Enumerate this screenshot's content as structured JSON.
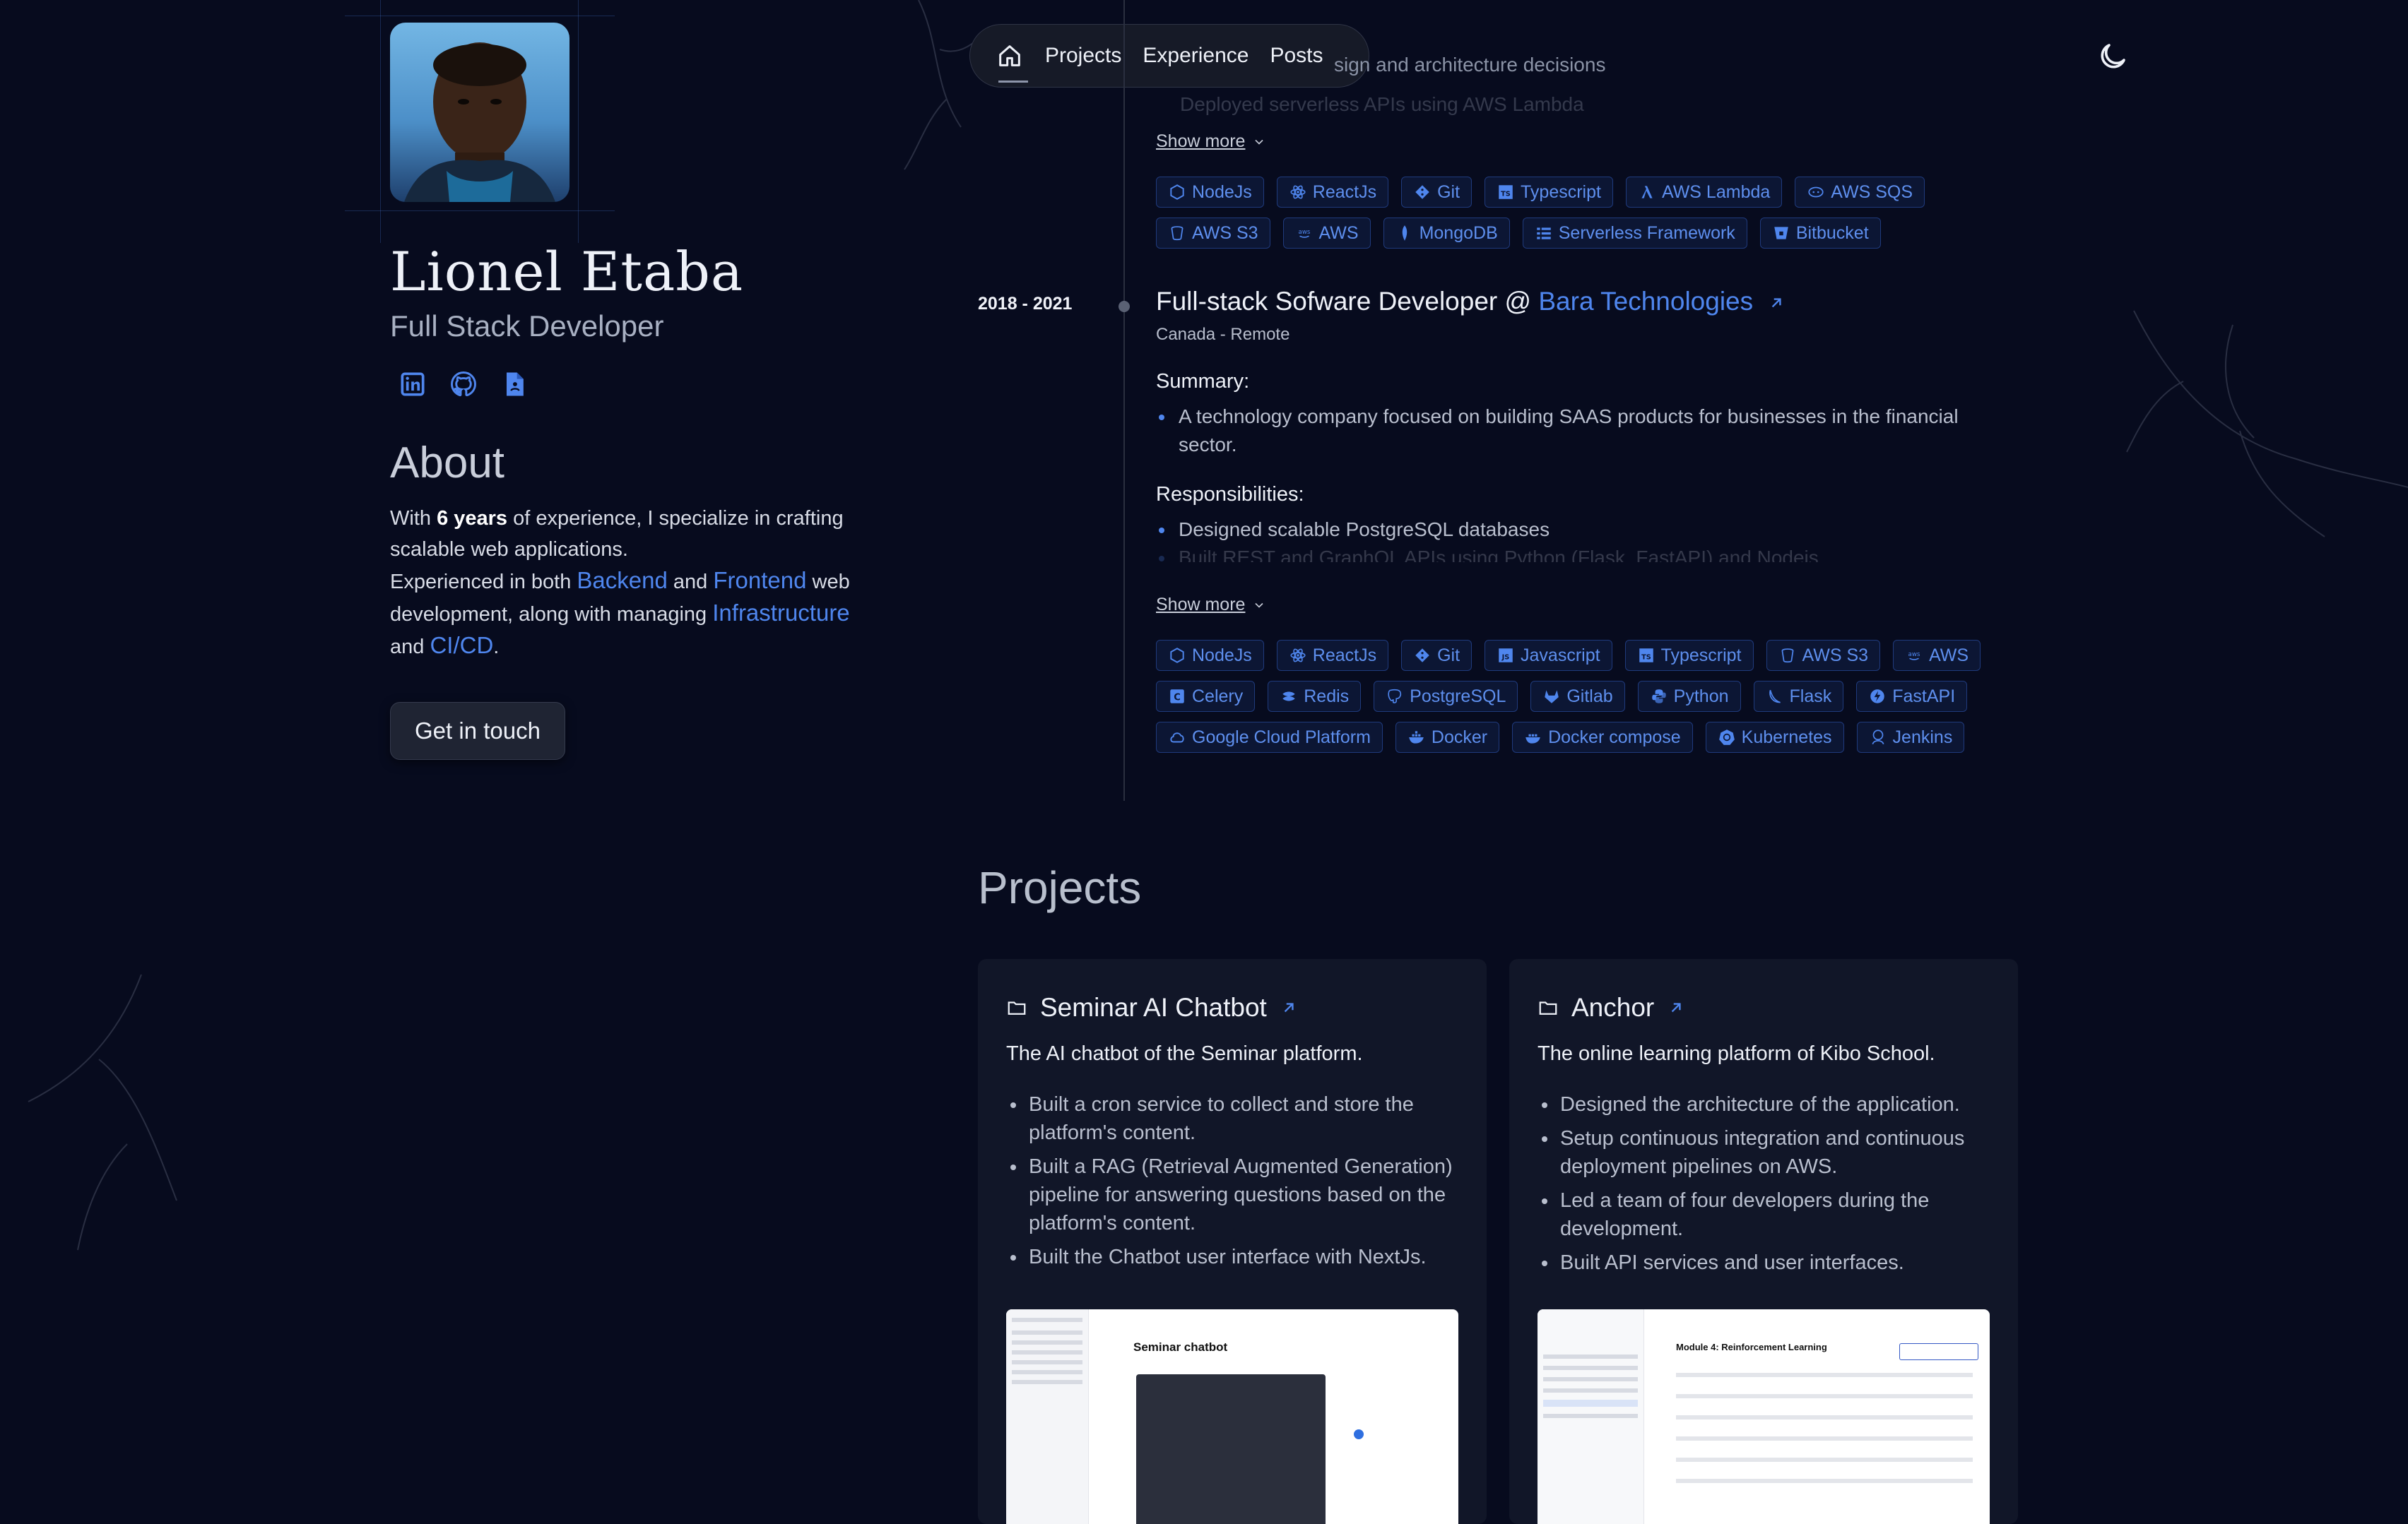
{
  "profile": {
    "name": "Lionel Etaba",
    "role": "Full Stack Developer"
  },
  "about": {
    "heading": "About",
    "p1_pre": "With ",
    "p1_bold": "6 years",
    "p1_post": " of experience, I specialize in crafting scalable web applications.",
    "p2_pre": "Experienced in both ",
    "link_backend": "Backend",
    "and1": " and ",
    "link_frontend": "Frontend",
    "p2_mid": " web development, along with managing ",
    "link_infra": "Infrastructure",
    "and2": " and ",
    "link_cicd": "CI/CD",
    "period": "."
  },
  "cta": "Get in touch",
  "nav": {
    "items": [
      "Projects",
      "Experience",
      "Posts"
    ]
  },
  "previous_job": {
    "line1": "sign and architecture decisions",
    "line2": "Deployed serverless APIs using AWS Lambda",
    "show_more": "Show more",
    "tags": [
      "NodeJs",
      "ReactJs",
      "Git",
      "Typescript",
      "AWS Lambda",
      "AWS SQS",
      "AWS S3",
      "AWS",
      "MongoDB",
      "Serverless Framework",
      "Bitbucket"
    ]
  },
  "job": {
    "dates": "2018 - 2021",
    "title_pre": "Full-stack Sofware Developer @ ",
    "company": "Bara Technologies",
    "location": "Canada - Remote",
    "summary_label": "Summary:",
    "summary": [
      "A technology company focused on building SAAS products for businesses in the financial sector."
    ],
    "responsibilities_label": "Responsibilities:",
    "responsibilities": [
      "Designed scalable PostgreSQL databases",
      "Built REST and GraphQL APIs using Python (Flask, FastAPI) and Nodejs"
    ],
    "show_more": "Show more",
    "tags": [
      "NodeJs",
      "ReactJs",
      "Git",
      "Javascript",
      "Typescript",
      "AWS S3",
      "AWS",
      "Celery",
      "Redis",
      "PostgreSQL",
      "Gitlab",
      "Python",
      "Flask",
      "FastAPI",
      "Google Cloud Platform",
      "Docker",
      "Docker compose",
      "Kubernetes",
      "Jenkins"
    ]
  },
  "projects": {
    "heading": "Projects",
    "cards": [
      {
        "title": "Seminar AI Chatbot",
        "description": "The AI chatbot of the Seminar platform.",
        "bullets": [
          "Built a cron service to collect and store the platform's content.",
          "Built a RAG (Retrieval Augmented Generation) pipeline for answering questions based on the platform's content.",
          "Built the Chatbot user interface with NextJs."
        ],
        "screenshot_title": "Seminar chatbot"
      },
      {
        "title": "Anchor",
        "description": "The online learning platform of Kibo School.",
        "bullets": [
          "Designed the architecture of the application.",
          "Setup continuous integration and continuous deployment pipelines on AWS.",
          "Led a team of four developers during the development.",
          "Built API services and user interfaces."
        ],
        "screenshot_title": "Module 4: Reinforcement Learning"
      }
    ]
  },
  "colors": {
    "accent": "#4f86ee",
    "background": "#070b1e",
    "tag_bg": "#0c1634"
  }
}
